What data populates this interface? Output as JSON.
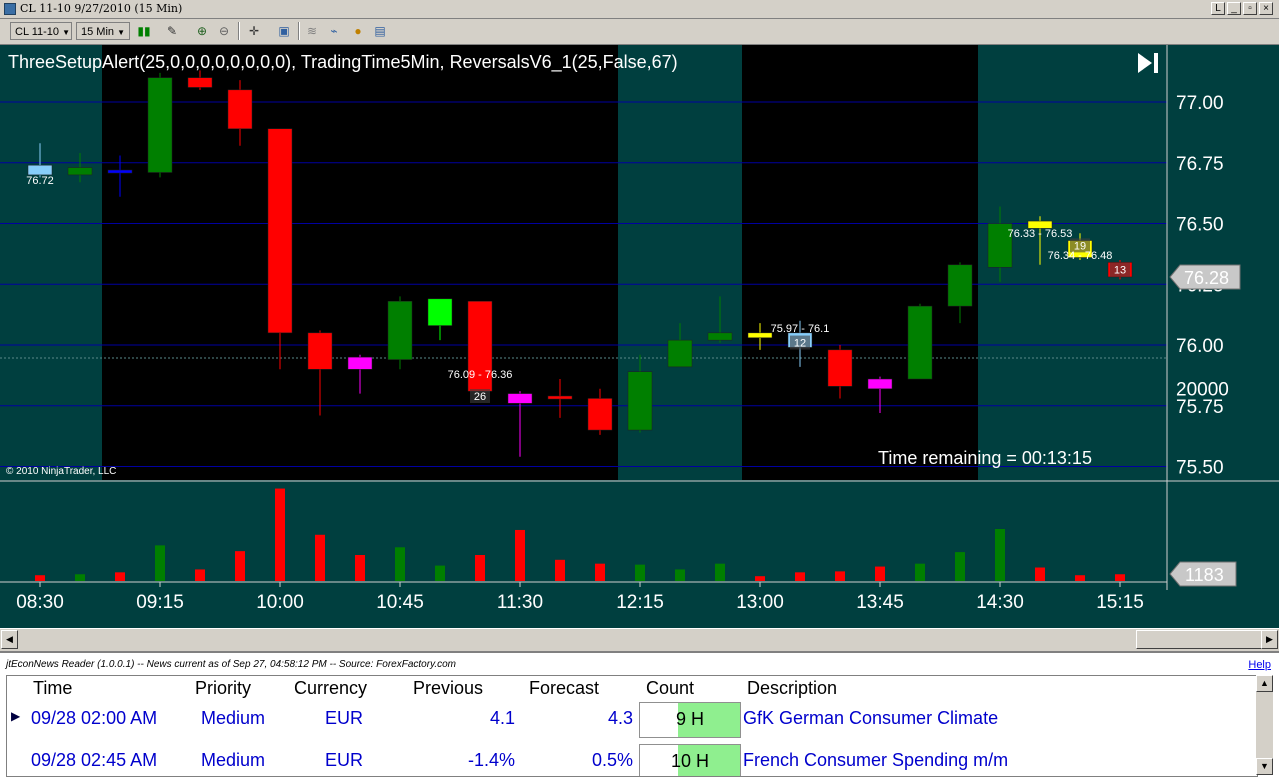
{
  "window": {
    "title": "CL 11-10  9/27/2010 (15 Min)",
    "controls": [
      "L",
      "_",
      "▫",
      "×"
    ]
  },
  "toolbar": {
    "instrument": "CL 11-10",
    "interval": "15 Min"
  },
  "chart": {
    "indicators_label": "ThreeSetupAlert(25,0,0,0,0,0,0,0,0), TradingTime5Min, ReversalsV6_1(25,False,67)",
    "copyright": "© 2010 NinjaTrader, LLC",
    "time_remaining": "Time remaining = 00:13:15",
    "last_price": "76.28",
    "last_volume": "1183",
    "colors": {
      "background": "#003f3f",
      "session_bg": "#000000",
      "up": "#007f00",
      "down": "#ff0000",
      "grid": "#0000a0"
    }
  },
  "chart_data": {
    "type": "candlestick",
    "x_tick_labels": [
      "08:30",
      "09:15",
      "10:00",
      "10:45",
      "11:30",
      "12:15",
      "13:00",
      "13:45",
      "14:30",
      "15:15"
    ],
    "y_tick_labels": [
      "77.00",
      "76.75",
      "76.50",
      "76.25",
      "76.00",
      "75.75",
      "75.50"
    ],
    "volume_tick_labels": [
      "20000"
    ],
    "annotations": [
      {
        "bar": 0,
        "text": "76.72",
        "y": 76.68
      },
      {
        "bar": 11,
        "text": "76.09 - 76.36",
        "y": 75.88
      },
      {
        "bar": 11,
        "text": "26",
        "y": 75.79,
        "boxed": true
      },
      {
        "bar": 19,
        "text": "75.97 - 76.1",
        "y": 76.07
      },
      {
        "bar": 19,
        "text": "12",
        "y": 76.01,
        "boxed": true
      },
      {
        "bar": 25,
        "text": "76.33 - 76.53",
        "y": 76.46
      },
      {
        "bar": 26,
        "text": "19",
        "y": 76.41,
        "boxed": true
      },
      {
        "bar": 26,
        "text": "76.34 - 76.48",
        "y": 76.37
      },
      {
        "bar": 27,
        "text": "13",
        "y": 76.31,
        "boxed": true
      }
    ],
    "session_periods": [
      [
        2,
        14
      ],
      [
        18,
        23
      ]
    ],
    "candles": [
      {
        "t": "08:30",
        "o": 76.74,
        "h": 76.83,
        "l": 76.69,
        "c": 76.7,
        "color": "#87cefa",
        "vol": 600
      },
      {
        "t": "08:45",
        "o": 76.7,
        "h": 76.79,
        "l": 76.67,
        "c": 76.73,
        "color": "#007f00",
        "vol": 700
      },
      {
        "t": "09:00",
        "o": 76.72,
        "h": 76.78,
        "l": 76.61,
        "c": 76.71,
        "color": "#0000ff",
        "vol": 900
      },
      {
        "t": "09:15",
        "o": 76.71,
        "h": 77.12,
        "l": 76.69,
        "c": 77.1,
        "color": "#007f00",
        "vol": 3700
      },
      {
        "t": "09:30",
        "o": 77.1,
        "h": 77.13,
        "l": 77.05,
        "c": 77.06,
        "color": "#ff0000",
        "vol": 1200
      },
      {
        "t": "09:45",
        "o": 77.05,
        "h": 77.09,
        "l": 76.82,
        "c": 76.89,
        "color": "#ff0000",
        "vol": 3100
      },
      {
        "t": "10:00",
        "o": 76.89,
        "h": 76.89,
        "l": 75.9,
        "c": 76.05,
        "color": "#ff0000",
        "vol": 9600
      },
      {
        "t": "10:15",
        "o": 76.05,
        "h": 76.06,
        "l": 75.71,
        "c": 75.9,
        "color": "#ff0000",
        "vol": 4800
      },
      {
        "t": "10:30",
        "o": 75.95,
        "h": 75.96,
        "l": 75.8,
        "c": 75.9,
        "color": "#ff00ff",
        "vol": 2700
      },
      {
        "t": "10:45",
        "o": 75.94,
        "h": 76.2,
        "l": 75.9,
        "c": 76.18,
        "color": "#007f00",
        "vol": 3500
      },
      {
        "t": "11:00",
        "o": 76.08,
        "h": 76.17,
        "l": 76.02,
        "c": 76.19,
        "color": "#00ff00",
        "vol": 1600
      },
      {
        "t": "11:15",
        "o": 76.18,
        "h": 76.18,
        "l": 75.81,
        "c": 75.81,
        "color": "#ff0000",
        "vol": 2700
      },
      {
        "t": "11:30",
        "o": 75.8,
        "h": 75.81,
        "l": 75.54,
        "c": 75.76,
        "color": "#ff00ff",
        "vol": 5300
      },
      {
        "t": "11:45",
        "o": 75.79,
        "h": 75.86,
        "l": 75.7,
        "c": 75.78,
        "color": "#ff0000",
        "vol": 2200
      },
      {
        "t": "12:00",
        "o": 75.78,
        "h": 75.82,
        "l": 75.63,
        "c": 75.65,
        "color": "#ff0000",
        "vol": 1800
      },
      {
        "t": "12:15",
        "o": 75.65,
        "h": 75.96,
        "l": 75.64,
        "c": 75.89,
        "color": "#007f00",
        "vol": 1700
      },
      {
        "t": "12:30",
        "o": 75.91,
        "h": 76.09,
        "l": 75.91,
        "c": 76.02,
        "color": "#007f00",
        "vol": 1200
      },
      {
        "t": "12:45",
        "o": 76.02,
        "h": 76.2,
        "l": 76.01,
        "c": 76.05,
        "color": "#007f00",
        "vol": 1800
      },
      {
        "t": "13:00",
        "o": 76.05,
        "h": 76.09,
        "l": 75.98,
        "c": 76.03,
        "color": "#ffff00",
        "vol": 500
      },
      {
        "t": "13:15",
        "o": 76.05,
        "h": 76.1,
        "l": 75.91,
        "c": 75.99,
        "color": "#87cefa",
        "vol": 900
      },
      {
        "t": "13:30",
        "o": 75.98,
        "h": 76.0,
        "l": 75.78,
        "c": 75.83,
        "color": "#ff0000",
        "vol": 1000
      },
      {
        "t": "13:45",
        "o": 75.86,
        "h": 75.87,
        "l": 75.72,
        "c": 75.82,
        "color": "#ff00ff",
        "vol": 1500
      },
      {
        "t": "14:00",
        "o": 75.86,
        "h": 76.17,
        "l": 75.86,
        "c": 76.16,
        "color": "#007f00",
        "vol": 1800
      },
      {
        "t": "14:15",
        "o": 76.16,
        "h": 76.34,
        "l": 76.09,
        "c": 76.33,
        "color": "#007f00",
        "vol": 3000
      },
      {
        "t": "14:30",
        "o": 76.32,
        "h": 76.57,
        "l": 76.26,
        "c": 76.5,
        "color": "#007f00",
        "vol": 5400
      },
      {
        "t": "14:45",
        "o": 76.51,
        "h": 76.53,
        "l": 76.33,
        "c": 76.48,
        "color": "#ffff00",
        "vol": 1400
      },
      {
        "t": "15:00",
        "o": 76.43,
        "h": 76.46,
        "l": 76.35,
        "c": 76.36,
        "color": "#ffff00",
        "vol": 600
      },
      {
        "t": "15:15",
        "o": 76.34,
        "h": 76.35,
        "l": 76.27,
        "c": 76.28,
        "color": "#ff0000",
        "vol": 700
      }
    ]
  },
  "news": {
    "header": "jtEconNews Reader (1.0.0.1)  --  News current as of Sep 27, 04:58:12 PM  --  Source: ForexFactory.com",
    "help": "Help",
    "columns": [
      "Time",
      "Priority",
      "Currency",
      "Previous",
      "Forecast",
      "Count",
      "Description"
    ],
    "rows": [
      {
        "time": "09/28 02:00 AM",
        "priority": "Medium",
        "currency": "EUR",
        "previous": "4.1",
        "forecast": "4.3",
        "count": "9 H",
        "description": "GfK German Consumer Climate"
      },
      {
        "time": "09/28 02:45 AM",
        "priority": "Medium",
        "currency": "EUR",
        "previous": "-1.4%",
        "forecast": "0.5%",
        "count": "10 H",
        "description": "French Consumer Spending m/m"
      }
    ]
  }
}
